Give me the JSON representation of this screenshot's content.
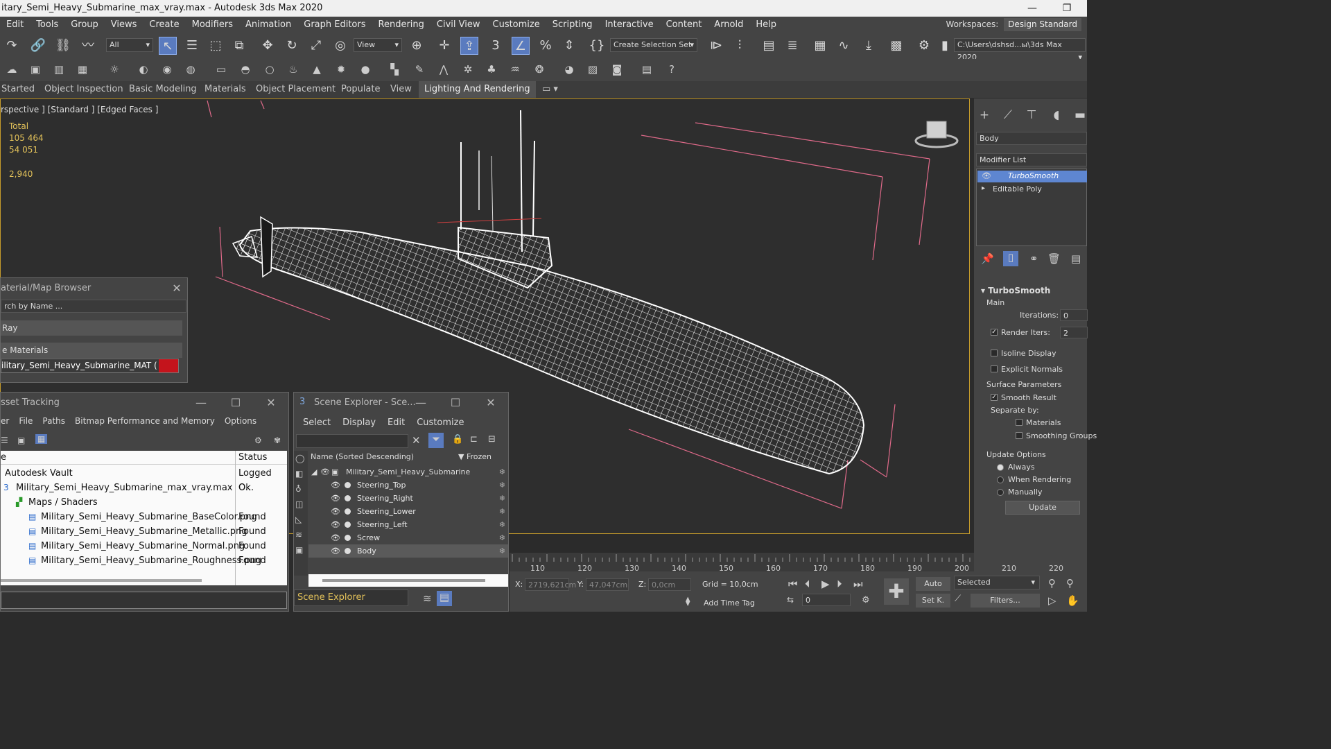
{
  "window": {
    "title": "itary_Semi_Heavy_Submarine_max_vray.max - Autodesk 3ds Max 2020",
    "minimize": "—",
    "maximize": "❐"
  },
  "menu": {
    "items": [
      "Edit",
      "Tools",
      "Group",
      "Views",
      "Create",
      "Modifiers",
      "Animation",
      "Graph Editors",
      "Rendering",
      "Civil View",
      "Customize",
      "Scripting",
      "Interactive",
      "Content",
      "Arnold",
      "Help"
    ],
    "workspaces_label": "Workspaces:",
    "workspace_value": "Design Standard"
  },
  "toolbar": {
    "filter": "All",
    "ref_coord": "View",
    "selection_set": "Create Selection Set",
    "project_path": "C:\\Users\\dshsd...ы\\3ds Max 2020"
  },
  "ribbon": {
    "tabs": [
      "Started",
      "Object Inspection",
      "Basic Modeling",
      "Materials",
      "Object Placement",
      "Populate",
      "View",
      "Lighting And Rendering"
    ]
  },
  "viewport": {
    "label": "rspective ] [Standard ] [Edged Faces ]",
    "stats": {
      "title": "Total",
      "polys": "105 464",
      "verts": "54 051",
      "fps": "2,940"
    }
  },
  "command_panel": {
    "object_name": "Body",
    "modifier_list": "Modifier List",
    "stack": [
      "TurboSmooth",
      "Editable Poly"
    ],
    "rollout": {
      "title": "TurboSmooth",
      "main": "Main",
      "iterations_label": "Iterations:",
      "iterations": "0",
      "render_iters_label": "Render Iters:",
      "render_iters": "2",
      "isoline": "Isoline Display",
      "explicit_normals": "Explicit Normals",
      "surface_params": "Surface Parameters",
      "smooth_result": "Smooth Result",
      "separate_by": "Separate by:",
      "materials": "Materials",
      "smoothing_groups": "Smoothing Groups",
      "update_options": "Update Options",
      "always": "Always",
      "when_rendering": "When Rendering",
      "manually": "Manually",
      "update_button": "Update"
    }
  },
  "material_browser": {
    "title": "aterial/Map Browser",
    "search_placeholder": "rch by Name ...",
    "group1": "Ray",
    "group2": "e Materials",
    "material": "ilitary_Semi_Heavy_Submarine_MAT  ( VRayMt..."
  },
  "asset_tracking": {
    "title": "sset Tracking",
    "menu": [
      "er",
      "File",
      "Paths",
      "Bitmap Performance and Memory",
      "Options"
    ],
    "col_name": "e",
    "col_status": "Status",
    "rows": [
      {
        "name": "Autodesk Vault",
        "status": "Logged O..."
      },
      {
        "name": "Military_Semi_Heavy_Submarine_max_vray.max",
        "status": "Ok"
      },
      {
        "name": "Maps / Shaders",
        "status": ""
      },
      {
        "name": "Military_Semi_Heavy_Submarine_BaseColor.png",
        "status": "Found"
      },
      {
        "name": "Military_Semi_Heavy_Submarine_Metallic.png",
        "status": "Found"
      },
      {
        "name": "Military_Semi_Heavy_Submarine_Normal.png",
        "status": "Found"
      },
      {
        "name": "Military_Semi_Heavy_Submarine_Roughness.png",
        "status": "Found"
      }
    ]
  },
  "scene_explorer": {
    "title": "Scene Explorer - Sce...",
    "menu": [
      "Select",
      "Display",
      "Edit",
      "Customize"
    ],
    "col_name": "Name (Sorted Descending)",
    "col_frozen": "▼ Frozen",
    "root": "Military_Semi_Heavy_Submarine",
    "items": [
      "Steering_Top",
      "Steering_Right",
      "Steering_Lower",
      "Steering_Left",
      "Screw",
      "Body"
    ],
    "footer": "Scene Explorer"
  },
  "timeline": {
    "ticks": [
      "110",
      "120",
      "130",
      "140",
      "150",
      "160",
      "170",
      "180",
      "190",
      "200",
      "210",
      "220"
    ]
  },
  "statusbar": {
    "x_label": "X:",
    "x": "2719,621cm",
    "y_label": "Y:",
    "y": "47,047cm",
    "z_label": "Z:",
    "z": "0,0cm",
    "grid": "Grid = 10,0cm",
    "add_time_tag": "Add Time Tag",
    "auto": "Auto",
    "set_key": "Set K.",
    "selected": "Selected",
    "filters": "Filters...",
    "frame": "0"
  }
}
